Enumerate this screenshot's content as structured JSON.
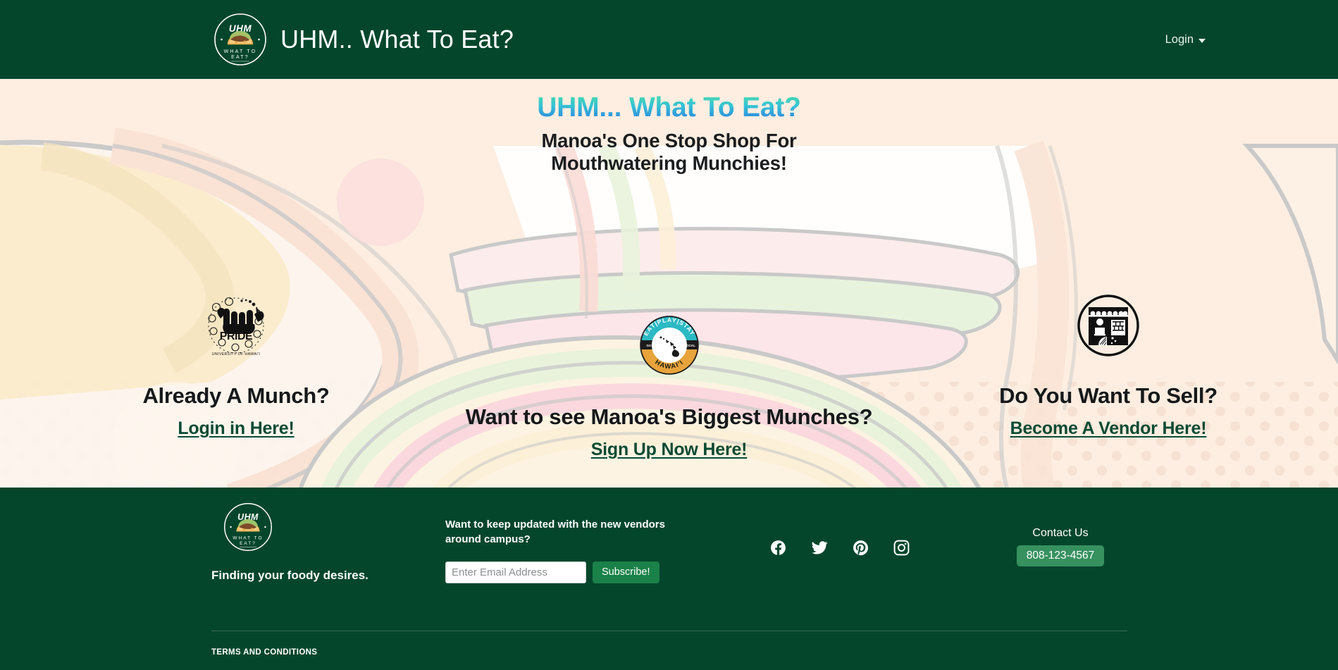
{
  "header": {
    "logo_icon": "uhm-taco-logo-icon",
    "logo_text_top": "UHM",
    "logo_text_mid": "WHAT TO",
    "logo_text_bot": "EAT?",
    "title": "UHM.. What To Eat?",
    "login_label": "Login",
    "caret_icon": "chevron-down-icon",
    "background_color": "#04462c"
  },
  "hero": {
    "title": "UHM... What To Eat?",
    "subtitle_line1": "Manoa's One Stop Shop For",
    "subtitle_line2": "Mouthwatering Munchies!",
    "title_gradient_from": "#4fe0a0",
    "title_gradient_to": "#2a74e6",
    "background_color": "#fdeee1",
    "columns": [
      {
        "icon": "uh-pride-shaka-icon",
        "icon_text_main": "PRIDE",
        "icon_text_sub": "UNIVERSITY OF HAWAI'I",
        "heading": "Already A Munch?",
        "link": "Login in Here!"
      },
      {
        "icon": "eat-play-stay-hawaii-badge-icon",
        "icon_text_top": "EAT|PLAY|STAY",
        "icon_text_left": "GO",
        "icon_text_right": "LOCAL",
        "icon_text_bottom": "HAWAI'I",
        "heading": "Want to see Manoa's Biggest Munches?",
        "link": "Sign Up Now Here!"
      },
      {
        "icon": "vendor-market-stall-icon",
        "heading": "Do You Want To Sell?",
        "link": "Become A Vendor Here!"
      }
    ]
  },
  "footer": {
    "logo_icon": "uhm-taco-logo-icon",
    "logo_text_top": "UHM",
    "logo_text_mid": "WHAT TO",
    "logo_text_bot": "EAT?",
    "tagline": "Finding your foody desires.",
    "newsletter_text": "Want to keep updated with the new vendors around campus?",
    "email_placeholder": "Enter Email Address",
    "email_value": "",
    "subscribe_label": "Subscribe!",
    "socials": [
      {
        "name": "facebook-icon",
        "label": "Facebook"
      },
      {
        "name": "twitter-icon",
        "label": "Twitter"
      },
      {
        "name": "pinterest-icon",
        "label": "Pinterest"
      },
      {
        "name": "instagram-icon",
        "label": "Instagram"
      }
    ],
    "contact_label": "Contact Us",
    "phone": "808-123-4567",
    "terms_label": "TERMS AND CONDITIONS",
    "background_color": "#04462c",
    "subscribe_color": "#1a8149",
    "phone_button_color": "#36915f"
  }
}
